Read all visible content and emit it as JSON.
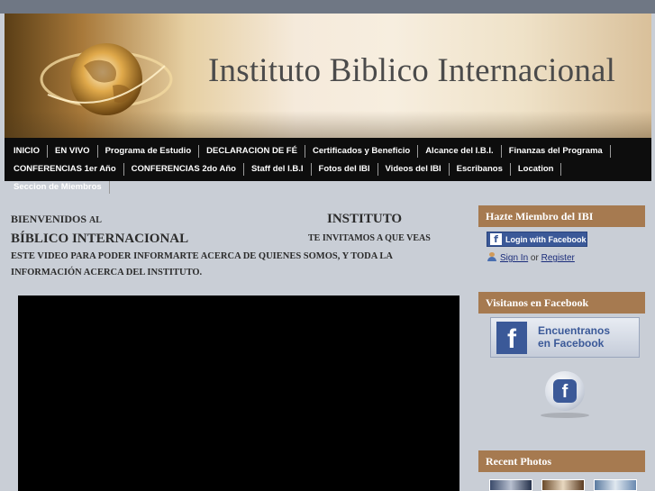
{
  "header": {
    "site_title": "Instituto Biblico Internacional"
  },
  "nav": {
    "items": [
      "INICIO",
      "EN VIVO",
      "Programa de Estudio",
      "DECLARACION DE FÉ",
      "Certificados y Beneficio",
      "Alcance del I.B.I.",
      "Finanzas del Programa",
      "CONFERENCIAS 1er Año",
      "CONFERENCIAS 2do Año",
      "Staff del I.B.I",
      "Fotos del IBI",
      "Videos del IBI",
      "Escribanos",
      "Location",
      "Seccion de Miembros"
    ]
  },
  "main": {
    "welcome_part1": "BIENVENIDOS",
    "welcome_part2": "AL",
    "welcome_part3": "INSTITUTO",
    "welcome_part4": "BÍBLICO INTERNACIONAL",
    "welcome_part5": "TE INVITAMOS A QUE VEAS",
    "welcome_part6": "ESTE VIDEO PARA PODER INFORMARTE ACERCA DE QUIENES SOMOS, Y TODA LA",
    "welcome_part7": "INFORMACIÓN ACERCA DEL INSTITUTO."
  },
  "sidebar": {
    "member_heading": "Hazte Miembro del IBI",
    "fb_login_label": "Login with Facebook",
    "sign_in": "Sign In",
    "or": "or",
    "register": "Register",
    "facebook_heading": "Visitanos en Facebook",
    "fb_banner_line1": "Encuentranos",
    "fb_banner_line2": "en Facebook",
    "photos_heading": "Recent Photos"
  },
  "colors": {
    "nav_bg": "#0d0d0d",
    "sidebar_heading_bg": "#a67a50",
    "facebook_blue": "#3b5998",
    "page_bg": "#c9ced6"
  }
}
